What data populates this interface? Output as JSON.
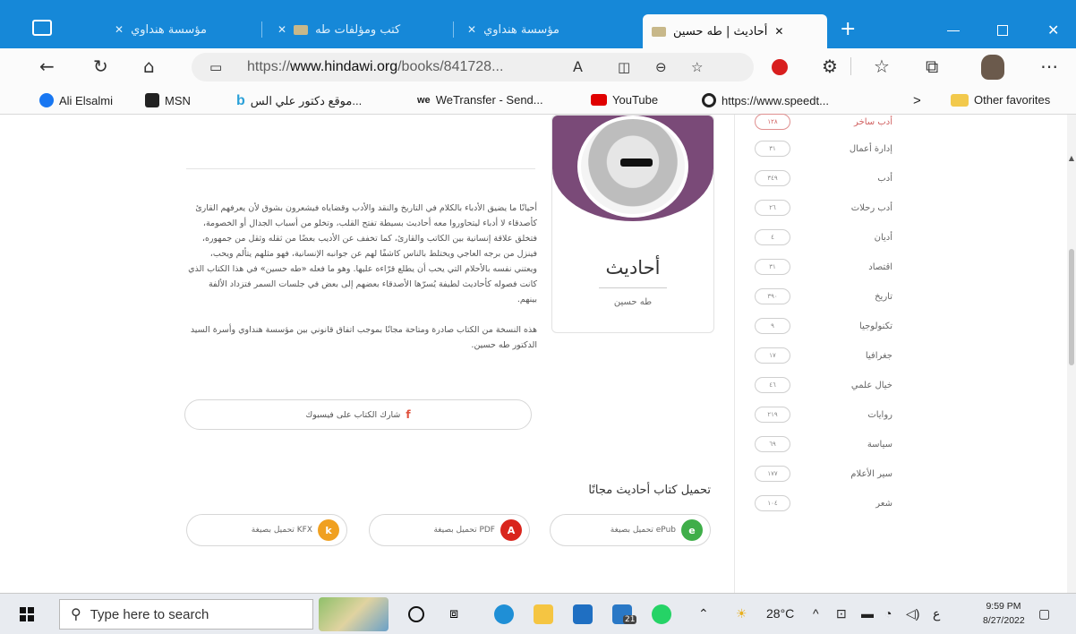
{
  "browser": {
    "tabs": [
      {
        "title": "مؤسسة هنداوي",
        "active": false
      },
      {
        "title": "كتب ومؤلفات طه",
        "active": false
      },
      {
        "title": "مؤسسة هنداوي",
        "active": false
      },
      {
        "title": "أحاديث | طه حسين",
        "active": true
      }
    ],
    "close_glyph": "✕",
    "new_tab_glyph": "+",
    "url_prefix": "https://",
    "url_domain": "www.hindawi.org",
    "url_path": "/books/841728...",
    "read_aloud_label": "A",
    "favorites": [
      {
        "label": "Ali Elsalmi",
        "icon": "facebook-icon",
        "color": "#1877f2"
      },
      {
        "label": "MSN",
        "icon": "msn-icon",
        "color": "#222222"
      },
      {
        "label": "موقع دكتور علي الس...",
        "icon": "bing-icon",
        "color": "#2aa0d8"
      },
      {
        "label": "WeTransfer - Send...",
        "icon": "wetransfer-icon",
        "color": "#222222"
      },
      {
        "label": "YouTube",
        "icon": "youtube-icon",
        "color": "#e00000"
      },
      {
        "label": "https://www.speedt...",
        "icon": "speedtest-icon",
        "color": "#222222"
      }
    ],
    "favorites_more": ">",
    "other_favorites": "Other favorites"
  },
  "book": {
    "title": "أحاديث",
    "author": "طه حسين",
    "description_paragraphs": [
      "أحيانًا ما يضيق الأدباء بالكلام في التاريخ والنقد والأدب وقضاياه فيشعرون بشوق لأن يعرفهم القارئ كأصدقاء لا أدباء ليتحاوروا معه أحاديث بسيطة تفتح القلب، وتخلو من أسباب الجدال أو الخصومة، فتخلق علاقة إنسانية بين الكاتب والقارئ، كما تخفف عن الأديب بعضًا من ثقله وثقل من جمهوره، فينزل من برجه العاجي ويختلط بالناس كاشفًا لهم عن جوانبه الإنسانية، فهو مثلهم يتألم ويحب، ويعتني نفسه بالأحلام التي يحب أن يطلع قرّاءه عليها. وهو ما فعله «طه حسين» في هذا الكتاب الذي كانت فصوله كأحاديث لطيفة يُسرّها الأصدقاء بعضهم إلى بعض في جلسات السمر فتزداد الألفة بينهم.",
      "هذه النسخة من الكتاب صادرة ومتاحة مجانًا بموجب اتفاق قانوني بين مؤسسة هنداوي وأسرة السيد الدكتور طه حسين."
    ],
    "share_label": "شارك الكتاب على فيسبوك",
    "share_icon_glyph": "f",
    "download_title": "تحميل كتاب أحاديث مجانًا",
    "downloads": [
      {
        "label": "تحميل بصيغة ePub",
        "icon": "epub-icon",
        "color": "#3fae49",
        "glyph": "e"
      },
      {
        "label": "تحميل بصيغة PDF",
        "icon": "pdf-icon",
        "color": "#d9251c",
        "glyph": "A"
      },
      {
        "label": "تحميل بصيغة KFX",
        "icon": "kfx-icon",
        "color": "#f0a020",
        "glyph": "k"
      }
    ]
  },
  "categories": [
    {
      "name": "أدب ساخر",
      "count": "١٢٨"
    },
    {
      "name": "إدارة أعمال",
      "count": "٣١"
    },
    {
      "name": "أدب",
      "count": "٣٤٩"
    },
    {
      "name": "أدب رحلات",
      "count": "٢٦"
    },
    {
      "name": "أديان",
      "count": "٤"
    },
    {
      "name": "اقتصاد",
      "count": "٣١"
    },
    {
      "name": "تاريخ",
      "count": "٣٩٠"
    },
    {
      "name": "تكنولوجيا",
      "count": "٩"
    },
    {
      "name": "جغرافيا",
      "count": "١٧"
    },
    {
      "name": "خيال علمي",
      "count": "٤٦"
    },
    {
      "name": "روايات",
      "count": "٢١٩"
    },
    {
      "name": "سياسة",
      "count": "٦٩"
    },
    {
      "name": "سير الأعلام",
      "count": "١٧٧"
    },
    {
      "name": "شعر",
      "count": "١٠٤"
    }
  ],
  "taskbar": {
    "search_placeholder": "Type here to search",
    "weather": "28°C",
    "time": "9:59 PM",
    "date": "8/27/2022",
    "mail_badge": "21",
    "lang": "ع"
  }
}
